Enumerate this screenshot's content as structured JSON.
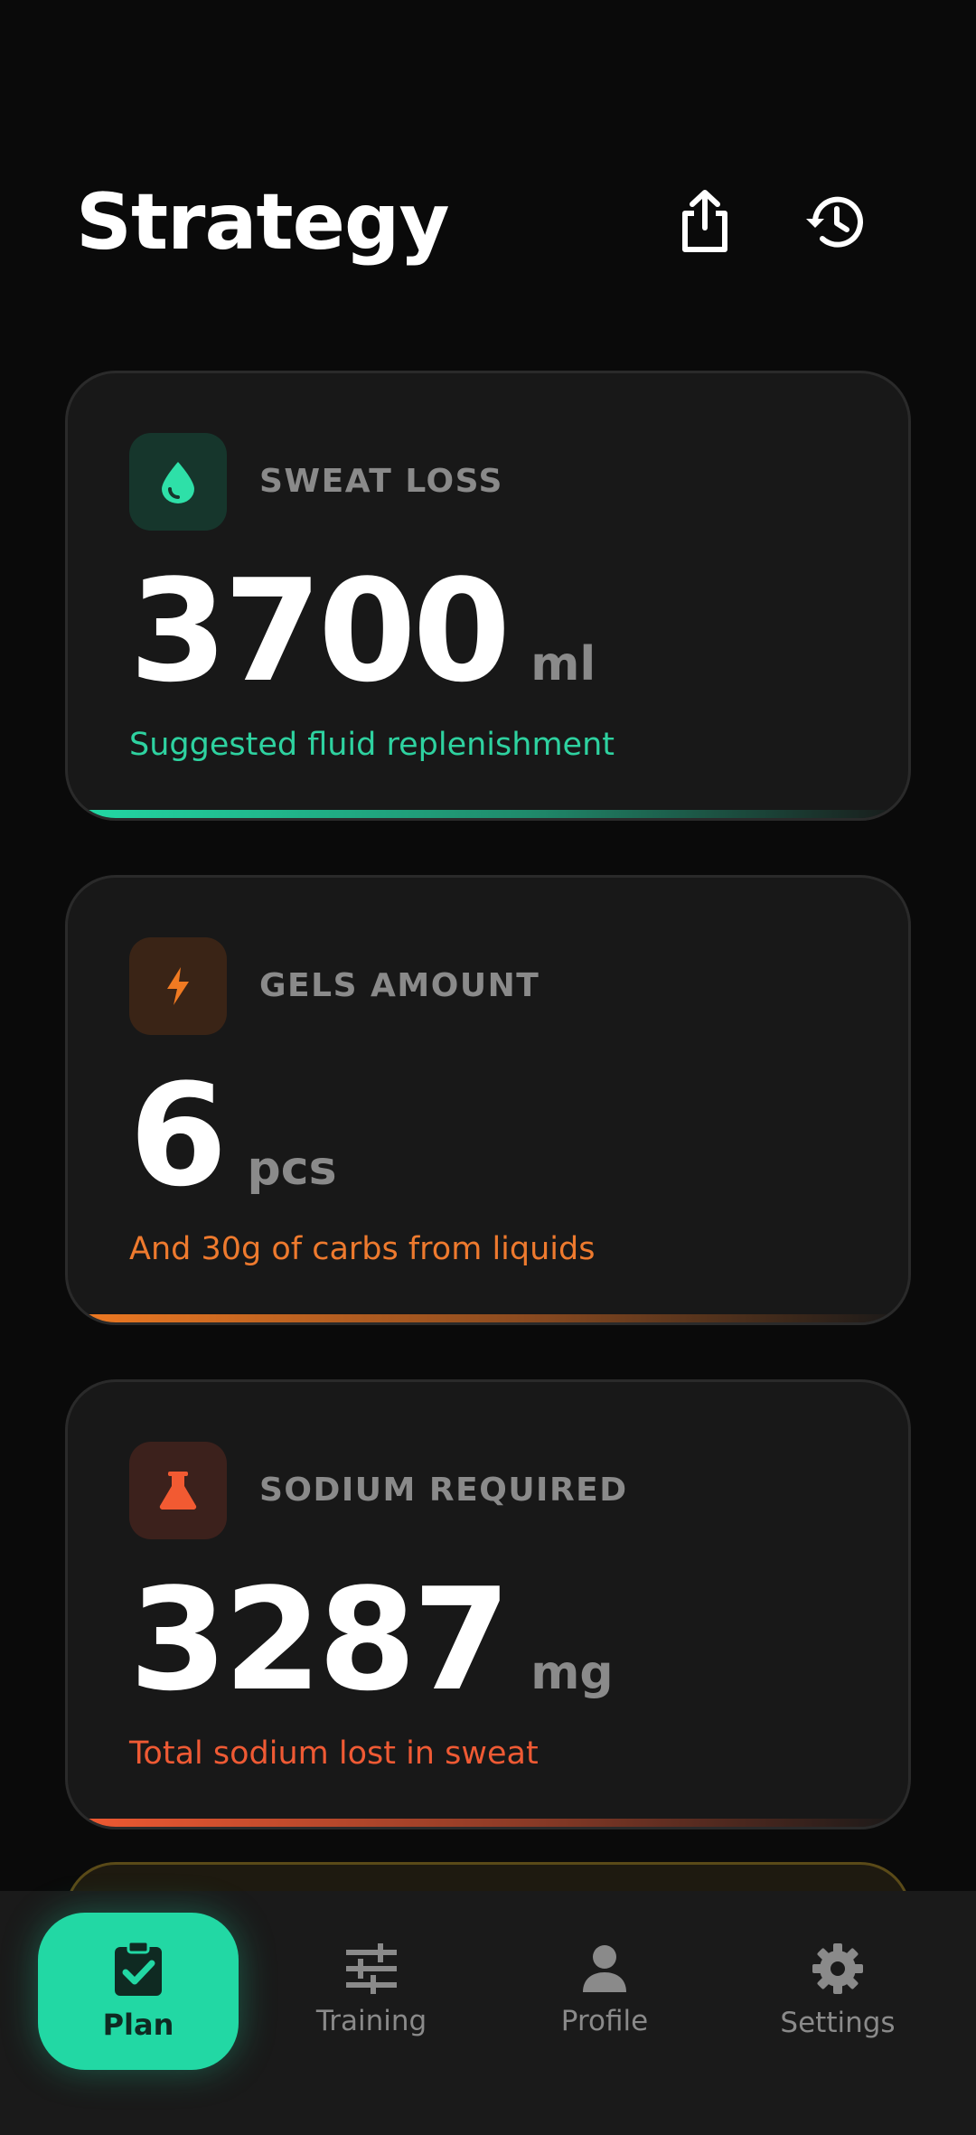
{
  "header": {
    "title": "Strategy",
    "share_icon": "share-icon",
    "history_icon": "history-icon"
  },
  "cards": [
    {
      "id": "sweat-loss",
      "icon": "water-drop-icon",
      "label": "SWEAT LOSS",
      "value": "3700",
      "unit": "ml",
      "subtitle": "Suggested fluid replenishment",
      "accent": "#22dba6"
    },
    {
      "id": "gels-amount",
      "icon": "lightning-bolt-icon",
      "label": "GELS AMOUNT",
      "value": "6",
      "unit": "pcs",
      "subtitle": "And 30g of carbs from liquids",
      "accent": "#f07a22"
    },
    {
      "id": "sodium-required",
      "icon": "flask-icon",
      "label": "SODIUM REQUIRED",
      "value": "3287",
      "unit": "mg",
      "subtitle": "Total sodium lost in sweat",
      "accent": "#f25a32"
    }
  ],
  "nav": {
    "items": [
      {
        "label": "Plan",
        "icon": "clipboard-check-icon",
        "active": true
      },
      {
        "label": "Training",
        "icon": "sliders-icon",
        "active": false
      },
      {
        "label": "Profile",
        "icon": "person-icon",
        "active": false
      },
      {
        "label": "Settings",
        "icon": "gear-icon",
        "active": false
      }
    ]
  }
}
